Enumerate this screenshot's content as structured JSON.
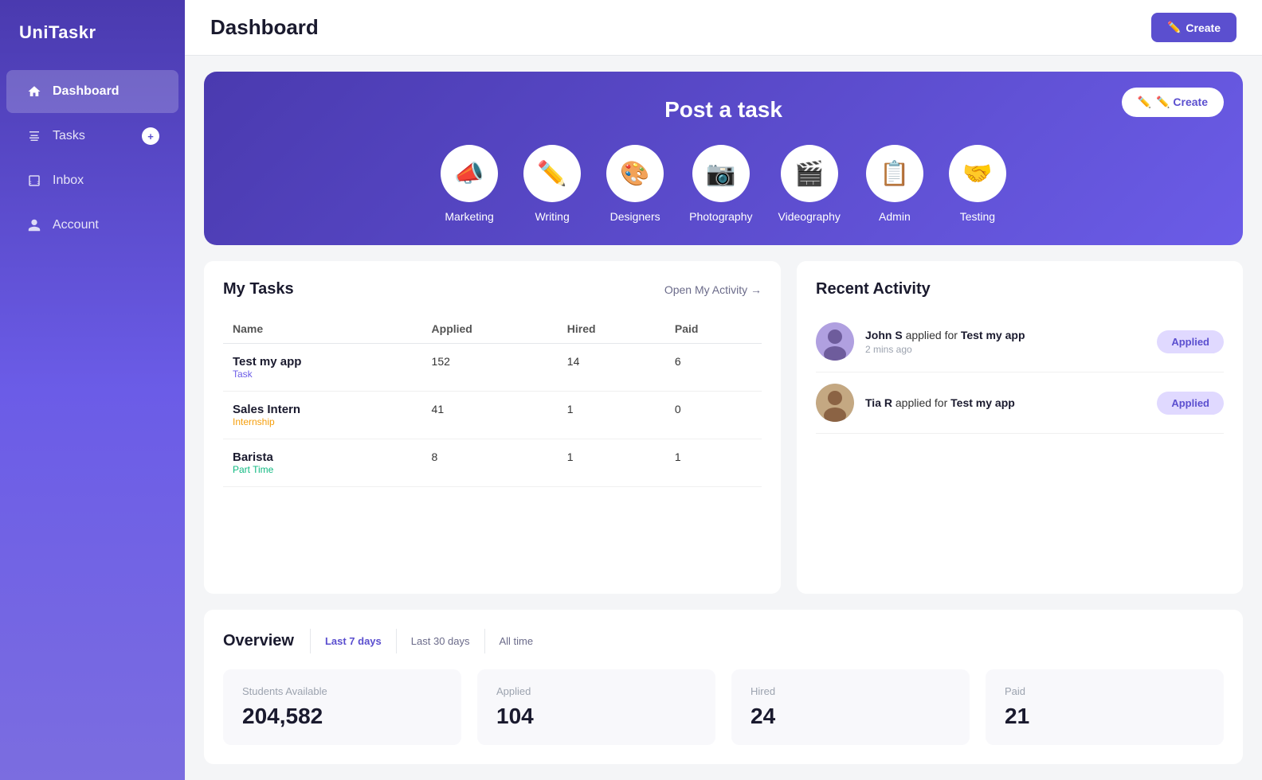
{
  "app": {
    "name": "UniTaskr"
  },
  "sidebar": {
    "items": [
      {
        "id": "dashboard",
        "label": "Dashboard",
        "icon": "🏠",
        "active": true
      },
      {
        "id": "tasks",
        "label": "Tasks",
        "icon": "📁",
        "badge": "+"
      },
      {
        "id": "inbox",
        "label": "Inbox",
        "icon": "📥"
      },
      {
        "id": "account",
        "label": "Account",
        "icon": "👤"
      }
    ]
  },
  "header": {
    "title": "Dashboard",
    "create_button": "Create"
  },
  "post_task": {
    "title": "Post a task",
    "create_label": "✏️ Create",
    "categories": [
      {
        "id": "marketing",
        "label": "Marketing",
        "icon": "📣"
      },
      {
        "id": "writing",
        "label": "Writing",
        "icon": "✏️"
      },
      {
        "id": "designers",
        "label": "Designers",
        "icon": "🎨"
      },
      {
        "id": "photography",
        "label": "Photography",
        "icon": "📷"
      },
      {
        "id": "videography",
        "label": "Videography",
        "icon": "🎬"
      },
      {
        "id": "admin",
        "label": "Admin",
        "icon": "📋"
      },
      {
        "id": "testing",
        "label": "Testing",
        "icon": "🤝"
      }
    ]
  },
  "my_tasks": {
    "title": "My Tasks",
    "open_activity_label": "Open My Activity →",
    "columns": [
      "Name",
      "Applied",
      "Hired",
      "Paid"
    ],
    "rows": [
      {
        "name": "Test my app",
        "type": "Task",
        "applied": "152",
        "hired": "14",
        "paid": "6"
      },
      {
        "name": "Sales Intern",
        "type": "Internship",
        "applied": "41",
        "hired": "1",
        "paid": "0"
      },
      {
        "name": "Barista",
        "type": "Part Time",
        "applied": "8",
        "hired": "1",
        "paid": "1"
      }
    ]
  },
  "recent_activity": {
    "title": "Recent Activity",
    "items": [
      {
        "name": "John S",
        "action": "applied for",
        "task": "Test my app",
        "timestamp": "2 mins ago",
        "badge": "Applied",
        "avatar_emoji": "👨"
      },
      {
        "name": "Tia R",
        "action": "applied for",
        "task": "Test my app",
        "timestamp": "",
        "badge": "Applied",
        "avatar_emoji": "👩"
      }
    ]
  },
  "overview": {
    "title": "Overview",
    "tabs": [
      "Last 7 days",
      "Last 30 days",
      "All time"
    ],
    "active_tab": "Last 7 days",
    "cards": [
      {
        "label": "Students Available",
        "value": "204,582"
      },
      {
        "label": "Applied",
        "value": "104"
      },
      {
        "label": "Hired",
        "value": "24"
      },
      {
        "label": "Paid",
        "value": "21"
      }
    ]
  },
  "colors": {
    "accent": "#5b4fcf",
    "sidebar_bg_start": "#4a3aaf",
    "sidebar_bg_end": "#7b6de0"
  }
}
